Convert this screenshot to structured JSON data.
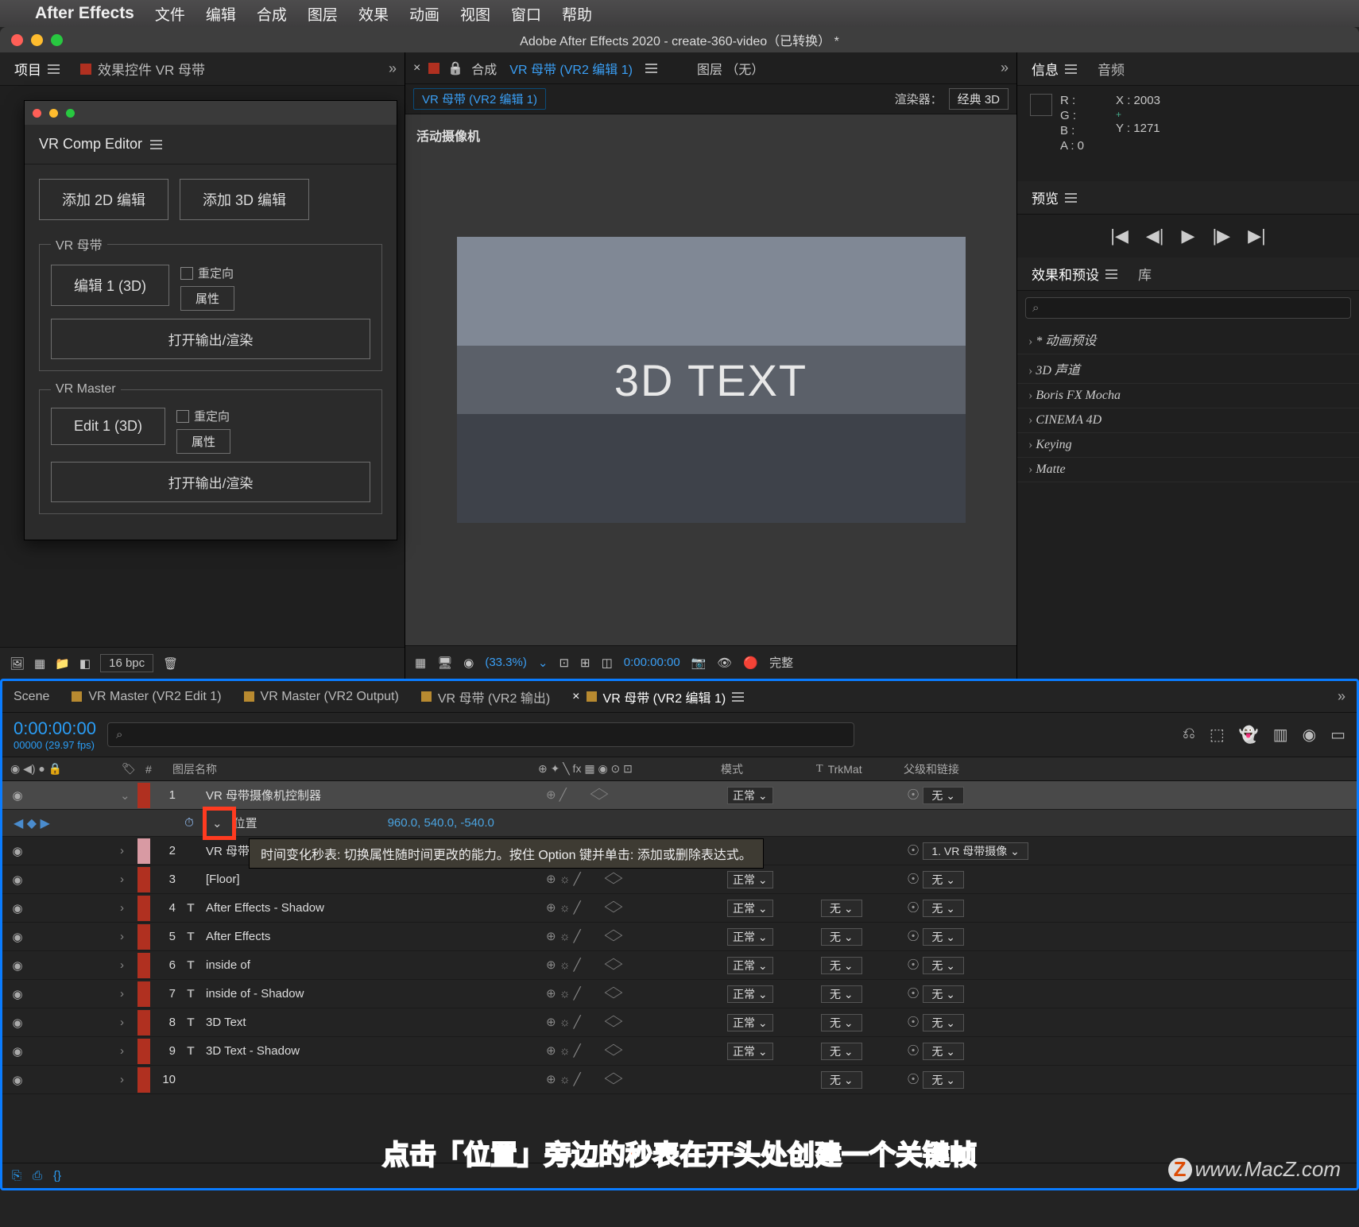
{
  "menubar": {
    "app": "After Effects",
    "items": [
      "文件",
      "编辑",
      "合成",
      "图层",
      "效果",
      "动画",
      "视图",
      "窗口",
      "帮助"
    ]
  },
  "window_title": "Adobe After Effects 2020 - create-360-video（已转换） *",
  "left": {
    "project_tab": "项目",
    "fx_tab": "效果控件 VR 母带"
  },
  "vrcomp": {
    "title": "VR Comp Editor",
    "add2d": "添加 2D 编辑",
    "add3d": "添加 3D 编辑",
    "group1": "VR 母带",
    "edit1": "编辑 1 (3D)",
    "reorient": "重定向",
    "props": "属性",
    "openrender": "打开输出/渲染",
    "group2": "VR Master",
    "edit2": "Edit 1 (3D)"
  },
  "comp": {
    "tab_prefix": "合成",
    "tab_name": "VR 母带 (VR2 编辑 1)",
    "layer_tab": "图层 （无）",
    "breadcrumb": "VR 母带 (VR2 编辑 1)",
    "renderer_label": "渲染器：",
    "renderer": "经典 3D",
    "active_cam": "活动摄像机",
    "canvas_text": "3D TEXT",
    "zoom": "(33.3%)",
    "time": "0:00:00:00",
    "full": "完整"
  },
  "info": {
    "title": "信息",
    "audio": "音频",
    "r": "R :",
    "g": "G :",
    "b": "B :",
    "a": "A :  0",
    "x": "X : 2003",
    "y": "Y : 1271"
  },
  "preview": {
    "title": "预览"
  },
  "fx": {
    "title": "效果和预设",
    "lib": "库",
    "search": "⌕",
    "items": [
      "* 动画预设",
      "3D 声道",
      "Boris FX Mocha",
      "CINEMA 4D",
      "Keying",
      "Matte"
    ]
  },
  "proj_tools": {
    "bpc": "16 bpc"
  },
  "timeline": {
    "tabs": [
      {
        "label": "Scene",
        "color": "gold"
      },
      {
        "label": "VR Master (VR2 Edit 1)",
        "color": "gold"
      },
      {
        "label": "VR Master (VR2 Output)",
        "color": "gold"
      },
      {
        "label": "VR 母带 (VR2 输出)",
        "color": "gold"
      },
      {
        "label": "VR 母带 (VR2 编辑 1)",
        "color": "gold",
        "active": true
      }
    ],
    "timecode": "0:00:00:00",
    "subtc": "00000 (29.97 fps)",
    "search": "⌕",
    "col_layer": "图层名称",
    "col_mode": "模式",
    "col_trk": "TrkMat",
    "col_parent": "父级和链接",
    "prop_name": "位置",
    "prop_val": "960.0, 540.0, -540.0",
    "tooltip": "时间变化秒表: 切换属性随时间更改的能力。按住 Option 键并单击: 添加或删除表达式。",
    "layers": [
      {
        "n": "1",
        "c": "red2",
        "i": "",
        "name": "VR 母带摄像机控制器",
        "mode": "正常",
        "trk": "",
        "parent": "无",
        "sel": true
      },
      {
        "n": "2",
        "c": "pink",
        "i": "",
        "name": "VR 母带摄像机",
        "mode": "",
        "trk": "",
        "parent": "1. VR 母带摄像"
      },
      {
        "n": "3",
        "c": "red2",
        "i": "",
        "name": "[Floor]",
        "mode": "正常",
        "trk": "",
        "parent": "无"
      },
      {
        "n": "4",
        "c": "red2",
        "i": "T",
        "name": "After Effects - Shadow",
        "mode": "正常",
        "trk": "无",
        "parent": "无"
      },
      {
        "n": "5",
        "c": "red2",
        "i": "T",
        "name": "After Effects",
        "mode": "正常",
        "trk": "无",
        "parent": "无"
      },
      {
        "n": "6",
        "c": "red2",
        "i": "T",
        "name": "inside of",
        "mode": "正常",
        "trk": "无",
        "parent": "无"
      },
      {
        "n": "7",
        "c": "red2",
        "i": "T",
        "name": "inside of - Shadow",
        "mode": "正常",
        "trk": "无",
        "parent": "无"
      },
      {
        "n": "8",
        "c": "red2",
        "i": "T",
        "name": "3D Text",
        "mode": "正常",
        "trk": "无",
        "parent": "无"
      },
      {
        "n": "9",
        "c": "red2",
        "i": "T",
        "name": "3D Text - Shadow",
        "mode": "正常",
        "trk": "无",
        "parent": "无"
      },
      {
        "n": "10",
        "c": "red2",
        "i": "",
        "name": "",
        "mode": "",
        "trk": "无",
        "parent": "无"
      }
    ]
  },
  "caption": "点击「位置」旁边的秒表在开头处创建一个关键帧",
  "watermark": "www.MacZ.com"
}
